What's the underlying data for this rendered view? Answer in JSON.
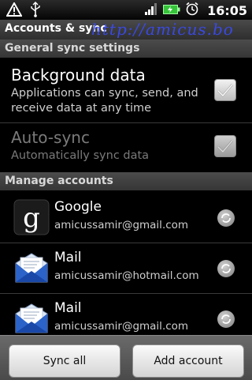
{
  "statusbar": {
    "time": "16:05"
  },
  "header": {
    "title": "Accounts & sync",
    "watermark": "http://amicus.bo"
  },
  "sections": {
    "general": "General sync settings",
    "manage": "Manage accounts"
  },
  "prefs": {
    "background": {
      "title": "Background data",
      "summary": "Applications can sync, send, and receive data at any time",
      "checked": true,
      "enabled": true
    },
    "autosync": {
      "title": "Auto-sync",
      "summary": "Automatically sync data",
      "checked": true,
      "enabled": false
    }
  },
  "accounts": [
    {
      "name": "Google",
      "email": "amicussamir@gmail.com",
      "icon": "google-icon"
    },
    {
      "name": "Mail",
      "email": "amicussamir@hotmail.com",
      "icon": "mail-icon"
    },
    {
      "name": "Mail",
      "email": "amicussamir@gmail.com",
      "icon": "mail-icon"
    }
  ],
  "buttons": {
    "sync_all": "Sync all",
    "add_account": "Add account"
  },
  "colors": {
    "watermark": "#3a4cff",
    "section_bg": "#404040",
    "battery": "#36c43a"
  }
}
